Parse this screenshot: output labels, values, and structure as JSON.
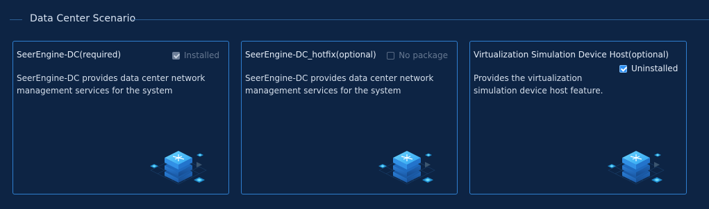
{
  "section": {
    "title": "Data Center Scenario"
  },
  "cards": [
    {
      "title": "SeerEngine-DC(required)",
      "status_label": "Installed",
      "checked": true,
      "disabled": true,
      "description": "SeerEngine-DC provides data center network management services for the system",
      "art_icon": "stacked-server-icon"
    },
    {
      "title": "SeerEngine-DC_hotfix(optional)",
      "status_label": "No package",
      "checked": false,
      "disabled": true,
      "description": "SeerEngine-DC provides data center network management services for the system",
      "art_icon": "stacked-server-icon"
    },
    {
      "title": "Virtualization Simulation Device Host(optional)",
      "status_label": "Uninstalled",
      "checked": true,
      "disabled": false,
      "description": "Provides the virtualization simulation device host feature.",
      "art_icon": "stacked-server-icon"
    }
  ],
  "colors": {
    "background": "#0d2444",
    "card_border": "#2f7fd0",
    "accent": "#2f8ff0",
    "disabled_text": "#667891"
  }
}
